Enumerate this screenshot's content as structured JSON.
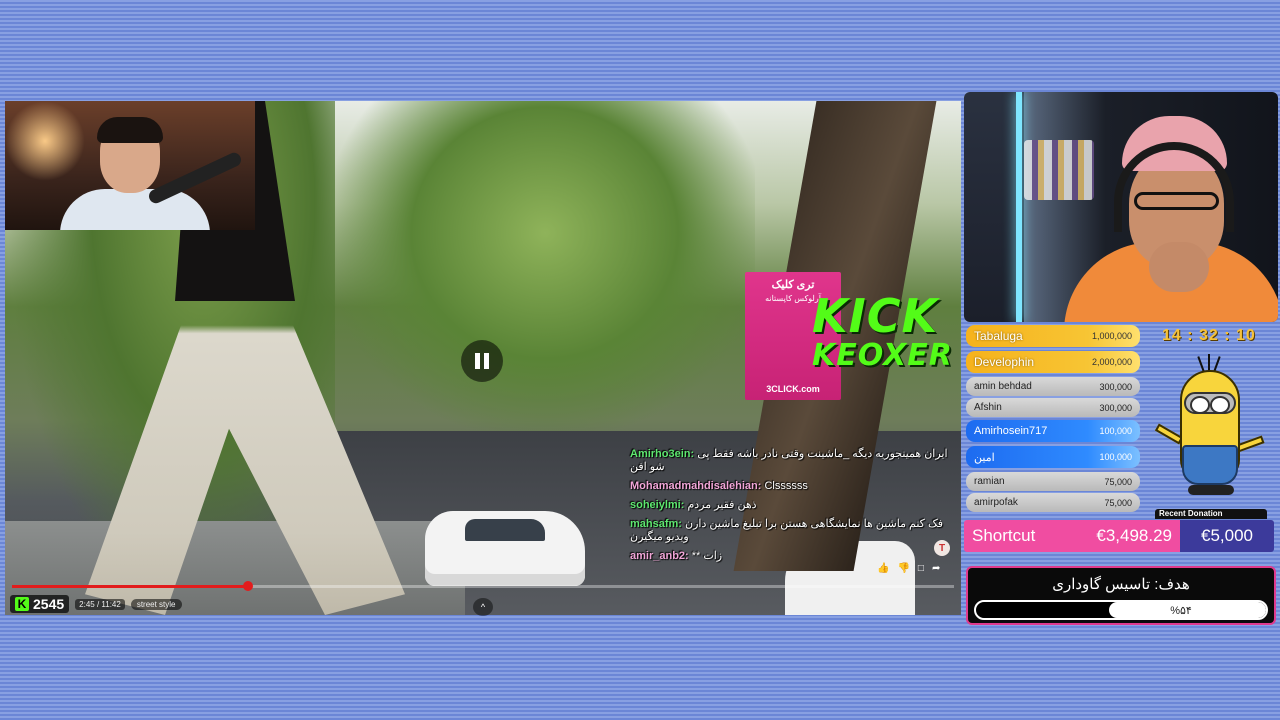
{
  "stream": {
    "viewer_count": "2545",
    "video_time": "2:45 / 11:42",
    "chapter": "street style",
    "watermark_top": "KICK",
    "watermark_bottom": "KEOXER",
    "progress_fraction": 0.25
  },
  "billboard": {
    "top_text": "تری کلیک",
    "sub_text": "آرلوکس کاپستانه",
    "brand": "3CLICK.com"
  },
  "chat": [
    {
      "user": "Amirho3ein:",
      "text": "ایران همینجوریه دیگه _ماشینت وقتی نادر باشه فقط پی شو افن",
      "color": "u-green"
    },
    {
      "user": "Mohamadmahdisalehian:",
      "text": "Clssssss",
      "color": "u-pink"
    },
    {
      "user": "soheiylmi:",
      "text": "ذهن فقیر مردم",
      "color": "u-green"
    },
    {
      "user": "mahsafm:",
      "text": "فک کنم ماشین ها نمایشگاهی هستن برا تبلیغ ماشین دارن ویدیو میگیرن",
      "color": "u-green"
    },
    {
      "user": "amir_anb2:",
      "text": "** زات",
      "color": "u-pink"
    }
  ],
  "leaderboard": [
    {
      "name": "Tabaluga",
      "amount": "1,000,000",
      "tier": "gold"
    },
    {
      "name": "Develophin",
      "amount": "2,000,000",
      "tier": "gold"
    },
    {
      "name": "amin behdad",
      "amount": "300,000",
      "tier": "gray"
    },
    {
      "name": "Afshin",
      "amount": "300,000",
      "tier": "gray"
    },
    {
      "name": "Amirhosein717",
      "amount": "100,000",
      "tier": "blue"
    },
    {
      "name": "امین",
      "amount": "100,000",
      "tier": "blue"
    },
    {
      "name": "ramian",
      "amount": "75,000",
      "tier": "gray"
    },
    {
      "name": "amirpofak",
      "amount": "75,000",
      "tier": "gray"
    }
  ],
  "clock": "14 : 32 : 10",
  "minion_label": "Recent Donation",
  "donation": {
    "label": "Shortcut",
    "current": "€3,498.29",
    "target": "€5,000"
  },
  "goal": {
    "title": "هدف: تاسیس گاوداری",
    "percent_label": "%۵۴",
    "fraction": 0.54
  },
  "colors": {
    "kick_green": "#53fc18",
    "donation_pink": "#f04da1",
    "donation_navy": "#3c3a9b",
    "progress_red": "#e21c1c",
    "clock_gold": "#f6c23a"
  },
  "icons": {
    "pause": "pause-icon",
    "expand": "chevron-up-icon",
    "settings": "gear-icon"
  }
}
